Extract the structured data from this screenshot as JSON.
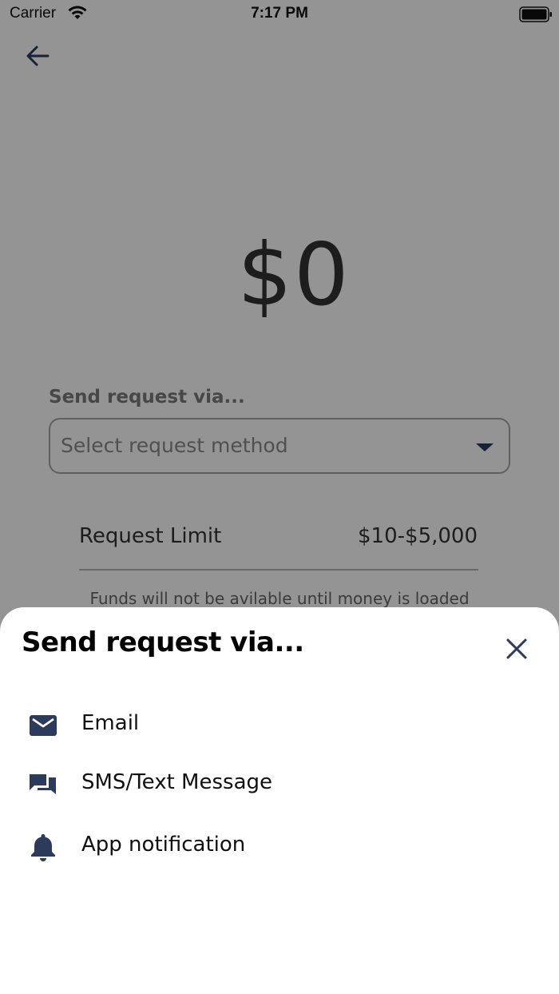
{
  "status_bar": {
    "carrier": "Carrier",
    "time": "7:17 PM"
  },
  "amount": "$0",
  "request_form": {
    "label": "Send request via...",
    "select_placeholder": "Select request method",
    "limit_label": "Request Limit",
    "limit_value": "$10-$5,000",
    "funds_note": "Funds will not be avilable until money is loaded"
  },
  "sheet": {
    "title": "Send request via...",
    "options": [
      {
        "label": "Email",
        "icon": "email-icon"
      },
      {
        "label": "SMS/Text Message",
        "icon": "chat-icon"
      },
      {
        "label": "App notification",
        "icon": "bell-icon"
      }
    ]
  },
  "colors": {
    "icon_navy": "#2c3a5c",
    "overlay": "#000000"
  }
}
